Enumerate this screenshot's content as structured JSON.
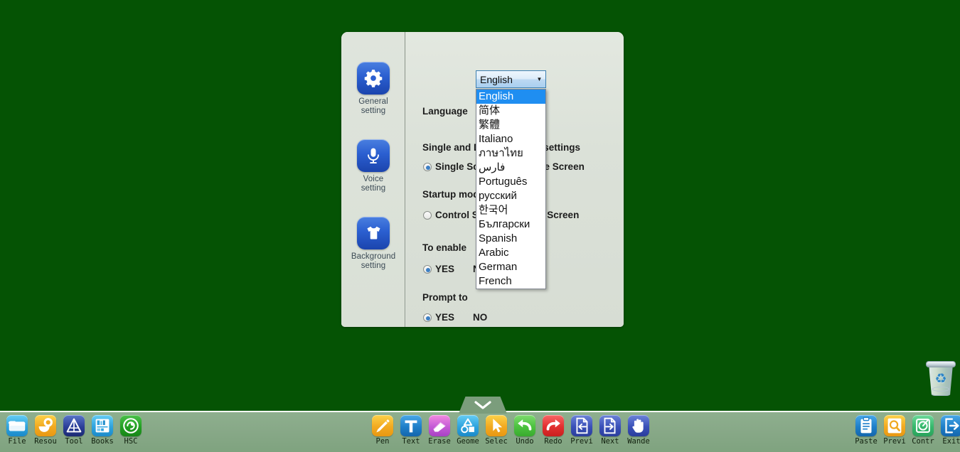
{
  "desktop": {
    "background_color": "#055304",
    "recycle_bin_label": ""
  },
  "dialog": {
    "sidebar": {
      "items": [
        {
          "icon": "gear-icon",
          "line1": "General",
          "line2": "setting"
        },
        {
          "icon": "microphone-icon",
          "line1": "Voice",
          "line2": "setting"
        },
        {
          "icon": "tshirt-icon",
          "line1": "Background",
          "line2": "setting"
        }
      ]
    },
    "fields": {
      "language_label": "Language",
      "single_double_heading": "Single and Double Screen settings",
      "single_screen_option": "Single Screen",
      "double_screen_option": "Double Screen",
      "startup_mode_heading": "Startup mode",
      "control_screen_option": "Control Screen",
      "main_screen_option": "Main Screen",
      "to_enable_heading": "To enable",
      "to_enable_yes": "YES",
      "to_enable_no": "NO",
      "prompt_to_heading": "Prompt to",
      "prompt_to_yes": "YES",
      "prompt_to_no": "NO"
    }
  },
  "combo": {
    "value": "English",
    "arrow_icon": "chevron-down-icon",
    "options": [
      "English",
      "简体",
      "繁體",
      "Italiano",
      "ภาษาไทย",
      "فارس",
      "Português",
      "русский",
      "한국어",
      "Български",
      "Spanish",
      "Arabic",
      "German",
      "French"
    ],
    "selected_index": 0,
    "highlight_color": "#1f8ef1"
  },
  "taskbar": {
    "background_color": "#87a887",
    "handle_icon": "chevron-down-icon",
    "left_items": [
      {
        "label": "File",
        "icon": "folder-icon"
      },
      {
        "label": "Resou",
        "icon": "resources-icon"
      },
      {
        "label": "Tool",
        "icon": "tool-icon"
      },
      {
        "label": "Books",
        "icon": "bookshelf-icon"
      },
      {
        "label": "HSC",
        "icon": "hsc-icon"
      }
    ],
    "center_items": [
      {
        "label": "Pen",
        "icon": "pen-icon"
      },
      {
        "label": "Text",
        "icon": "text-icon"
      },
      {
        "label": "Erase",
        "icon": "eraser-icon"
      },
      {
        "label": "Geome",
        "icon": "geometry-icon"
      },
      {
        "label": "Selec",
        "icon": "select-cursor-icon"
      },
      {
        "label": "Undo",
        "icon": "undo-arrow-icon"
      },
      {
        "label": "Redo",
        "icon": "redo-arrow-icon"
      },
      {
        "label": "Previ",
        "icon": "previous-page-icon"
      },
      {
        "label": "Next",
        "icon": "next-page-icon"
      },
      {
        "label": "Wande",
        "icon": "hand-icon"
      }
    ],
    "right_items": [
      {
        "label": "Paste",
        "icon": "clipboard-paste-icon"
      },
      {
        "label": "Previ",
        "icon": "preview-magnifier-icon"
      },
      {
        "label": "Contr",
        "icon": "control-icon"
      },
      {
        "label": "Exit",
        "icon": "exit-icon"
      }
    ]
  }
}
